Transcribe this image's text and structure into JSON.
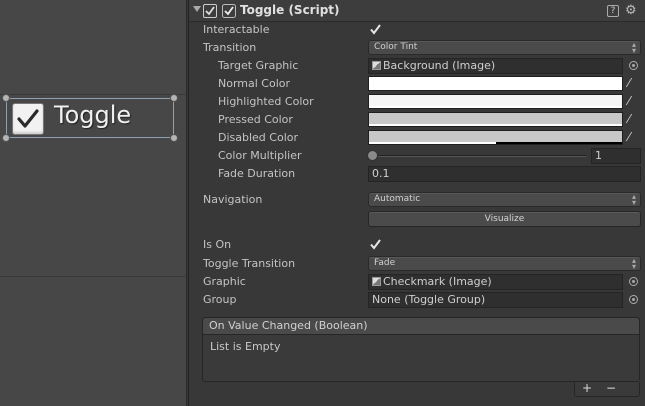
{
  "scene": {
    "toggle_label": "Toggle"
  },
  "component": {
    "title": "Toggle (Script)",
    "help_glyph": "?",
    "gear_glyph": "⚙"
  },
  "fields": {
    "interactable_label": "Interactable",
    "transition_label": "Transition",
    "transition_value": "Color Tint",
    "target_graphic_label": "Target Graphic",
    "target_graphic_value": "Background (Image)",
    "normal_color_label": "Normal Color",
    "highlighted_color_label": "Highlighted Color",
    "pressed_color_label": "Pressed Color",
    "disabled_color_label": "Disabled Color",
    "color_multiplier_label": "Color Multiplier",
    "color_multiplier_value": "1",
    "fade_duration_label": "Fade Duration",
    "fade_duration_value": "0.1",
    "navigation_label": "Navigation",
    "navigation_value": "Automatic",
    "visualize_label": "Visualize",
    "is_on_label": "Is On",
    "toggle_transition_label": "Toggle Transition",
    "toggle_transition_value": "Fade",
    "graphic_label": "Graphic",
    "graphic_value": "Checkmark (Image)",
    "group_label": "Group",
    "group_value": "None (Toggle Group)"
  },
  "colors": {
    "normal": "#ffffff",
    "highlighted": "#f5f5f5",
    "pressed": "#c8c8c8",
    "disabled": "#c8c8c8",
    "disabled_alpha_fraction": 0.5
  },
  "event": {
    "header": "On Value Changed (Boolean)",
    "empty_text": "List is Empty",
    "add_label": "+",
    "remove_label": "−"
  },
  "icons": {
    "foldout": "triangle-down-icon",
    "checkmark": "checkmark-icon",
    "eyedropper": "eyedropper-icon",
    "picker": "object-picker-icon"
  }
}
